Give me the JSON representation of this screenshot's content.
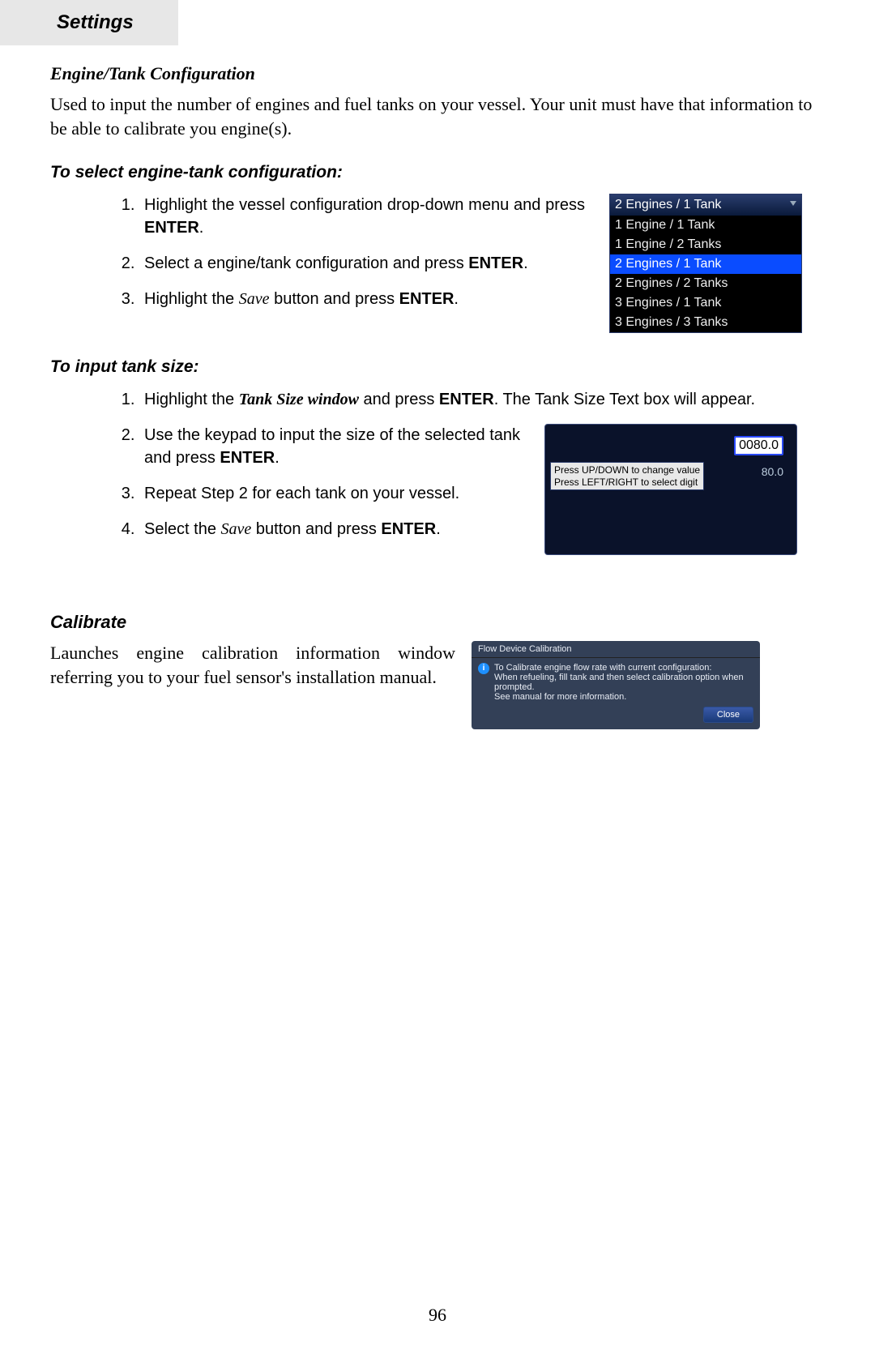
{
  "tab_title": "Settings",
  "section1": {
    "heading": "Engine/Tank Configuration",
    "body": "Used to input the number of engines and fuel tanks on your vessel. Your unit must have that information to be able to calibrate you engine(s)."
  },
  "procA": {
    "heading": "To select engine-tank configuration:",
    "steps": {
      "s1a": "Highlight the vessel configuration drop-down menu and press ",
      "s1b": ".",
      "s2a": "Select a engine/tank configuration and press ",
      "s2b": ".",
      "s3a": "Highlight the ",
      "s3b": " button and press ",
      "s3c": "."
    },
    "enter": "ENTER",
    "save": "Save"
  },
  "dropdown": {
    "top": "2 Engines / 1 Tank",
    "items": [
      "1 Engine / 1 Tank",
      "1 Engine / 2 Tanks",
      "2 Engines / 1 Tank",
      "2 Engines / 2 Tanks",
      "3 Engines / 1 Tank",
      "3 Engines / 3 Tanks"
    ],
    "selected_index": 2
  },
  "procB": {
    "heading": "To input tank size:",
    "steps": {
      "s1a": "Highlight the ",
      "s1b": " and press ",
      "s1c": ". The Tank Size Text box will appear.",
      "s1ital": "Tank Size window",
      "s2a": "Use the keypad to input the size of the selected tank and press ",
      "s2b": ".",
      "s3": "Repeat Step 2 for each tank on your vessel.",
      "s4a": "Select the ",
      "s4b": " button and press ",
      "s4c": "."
    },
    "enter": "ENTER",
    "save": "Save"
  },
  "tank": {
    "value": "0080.0",
    "tip1": "Press UP/DOWN to change value",
    "tip2": "Press LEFT/RIGHT to select digit",
    "ghost": "80.0"
  },
  "calibrate": {
    "heading": "Calibrate",
    "body": "Launches engine calibration information window referring you to your fuel sensor's installation manual.",
    "dialog_title": "Flow Device Calibration",
    "dialog_line1": "To Calibrate engine flow rate with current configuration:",
    "dialog_line2": "When refueling, fill tank and then select calibration option when prompted.",
    "dialog_line3": "See manual for more information.",
    "close": "Close",
    "info": "i"
  },
  "page_number": "96"
}
